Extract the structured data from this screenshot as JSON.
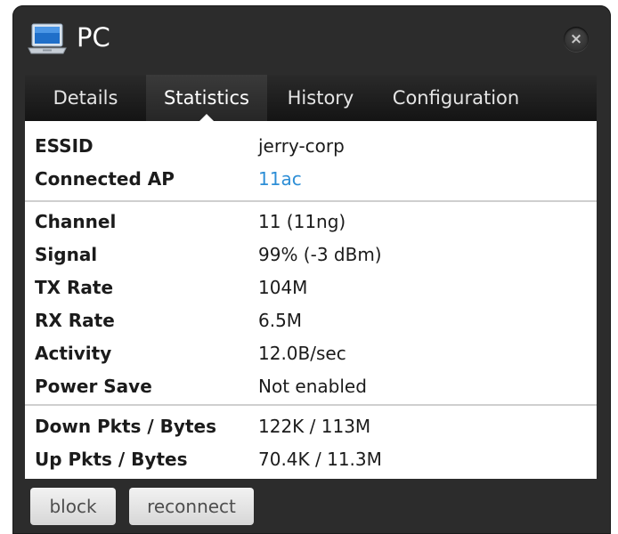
{
  "window": {
    "title": "PC",
    "close_label": "×"
  },
  "tabs": [
    {
      "label": "Details"
    },
    {
      "label": "Statistics"
    },
    {
      "label": "History"
    },
    {
      "label": "Configuration"
    }
  ],
  "active_tab": "Statistics",
  "connection": {
    "essid_label": "ESSID",
    "essid_value": "jerry-corp",
    "ap_label": "Connected AP",
    "ap_value": "11ac"
  },
  "radio": {
    "channel_label": "Channel",
    "channel_value": "11 (11ng)",
    "signal_label": "Signal",
    "signal_value": "99% (-3 dBm)",
    "tx_label": "TX Rate",
    "tx_value": "104M",
    "rx_label": "RX Rate",
    "rx_value": "6.5M",
    "activity_label": "Activity",
    "activity_value": "12.0B/sec",
    "powersave_label": "Power Save",
    "powersave_value": "Not enabled"
  },
  "traffic": {
    "down_label": "Down Pkts / Bytes",
    "down_value": "122K / 113M",
    "up_label": "Up Pkts / Bytes",
    "up_value": "70.4K / 11.3M"
  },
  "buttons": {
    "block": "block",
    "reconnect": "reconnect"
  },
  "colors": {
    "link": "#2d8ed6",
    "window_bg": "#2c2c2c"
  },
  "icons": {
    "title_icon": "laptop-icon",
    "close_icon": "close-icon"
  }
}
